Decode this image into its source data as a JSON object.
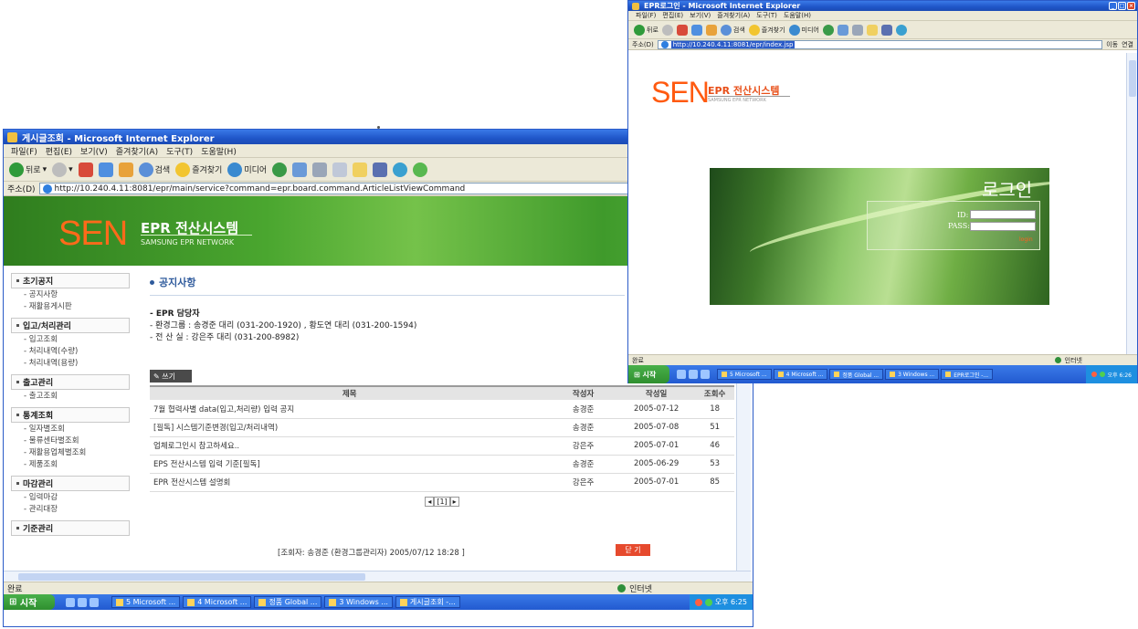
{
  "board_window": {
    "title": "게시글조회 - Microsoft Internet Explorer",
    "menu": [
      "파일(F)",
      "편집(E)",
      "보기(V)",
      "즐겨찾기(A)",
      "도구(T)",
      "도움말(H)"
    ],
    "toolbar": {
      "back": "뒤로",
      "search": "검색",
      "favorites": "즐겨찾기",
      "media": "미디어"
    },
    "address_label": "주소(D)",
    "url": "http://10.240.4.11:8081/epr/main/service?command=epr.board.command.ArticleListViewCommand",
    "banner": {
      "logo": "SEN",
      "title": "EPR 전산시스템",
      "subtitle": "SAMSUNG EPR NETWORK"
    },
    "sidebar": [
      {
        "label": "초기공지",
        "items": [
          "공지사항",
          "재활용게시판"
        ]
      },
      {
        "label": "입고/처리관리",
        "items": [
          "입고조회",
          "처리내역(수량)",
          "처리내역(용량)"
        ]
      },
      {
        "label": "출고관리",
        "items": [
          "출고조회"
        ]
      },
      {
        "label": "통계조회",
        "items": [
          "일자별조회",
          "물류센타별조회",
          "재활용업체별조회",
          "제품조회"
        ]
      },
      {
        "label": "마감관리",
        "items": [
          "입력마감",
          "관리대장"
        ]
      },
      {
        "label": "기준관리",
        "items": []
      }
    ],
    "page_title": "공지사항",
    "contact_heading": "- EPR 담당자",
    "contact_lines": [
      "- 환경그룹 : 송경준 대리 (031-200-1920) , 황도연 대리 (031-200-1594)",
      "- 전 산 실 : 강은주 대리 (031-200-8982)"
    ],
    "write_button": "쓰기",
    "table_headers": [
      "제목",
      "작성자",
      "작성일",
      "조회수"
    ],
    "rows": [
      {
        "title": "7월 협력사별 data(입고,처리량) 입력 공지",
        "author": "송경준",
        "date": "2005-07-12",
        "views": "18"
      },
      {
        "title": "[필독] 시스템기준변경(입고/처리내역)",
        "author": "송경준",
        "date": "2005-07-08",
        "views": "51"
      },
      {
        "title": "업체로그인시 참고하세요..",
        "author": "강은주",
        "date": "2005-07-01",
        "views": "46"
      },
      {
        "title": "EPS 전산시스템 입력 기준[필독]",
        "author": "송경준",
        "date": "2005-06-29",
        "views": "53"
      },
      {
        "title": "EPR 전산시스템 설명회",
        "author": "강은주",
        "date": "2005-07-01",
        "views": "85"
      }
    ],
    "pager": "[1]",
    "footer": "[조회자: 송경준 (환경그룹관리자) 2005/07/12 18:28 ]",
    "close_button": "닫 기",
    "status": "완료",
    "zone": "인터넷",
    "start": "시작",
    "tasks": [
      "5 Microsoft ...",
      "4 Microsoft ...",
      "정품 Global ...",
      "3 Windows ...",
      "게시글조회 -..."
    ],
    "clock": "오후 6:25"
  },
  "login_window": {
    "title": "EPR로그인 - Microsoft Internet Explorer",
    "menu": [
      "파일(F)",
      "편집(E)",
      "보기(V)",
      "즐겨찾기(A)",
      "도구(T)",
      "도움말(H)"
    ],
    "toolbar": {
      "back": "뒤로",
      "search": "검색",
      "favorites": "즐겨찾기",
      "media": "미디어"
    },
    "address_label": "주소(D)",
    "url": "http://10.240.4.11:8081/epr/index.jsp",
    "go": "이동",
    "links": "연결",
    "banner": {
      "logo": "SEN",
      "title": "EPR 전산시스템",
      "subtitle": "SAMSUNG EPR NETWORK"
    },
    "login_title": "로그인",
    "id_label": "ID:",
    "pass_label": "PASS:",
    "login_button": "login",
    "status": "완료",
    "zone": "인터넷",
    "start": "시작",
    "tasks": [
      "5 Microsoft ...",
      "4 Microsoft ...",
      "정품 Global ...",
      "3 Windows ...",
      "EPR로그인 -..."
    ],
    "clock": "오후 6:26"
  },
  "colors": {
    "accent": "#2e5a9c",
    "logo": "#ff6a1a",
    "titlebar": "#1f55c8",
    "banner_green": "#4aa62f"
  }
}
